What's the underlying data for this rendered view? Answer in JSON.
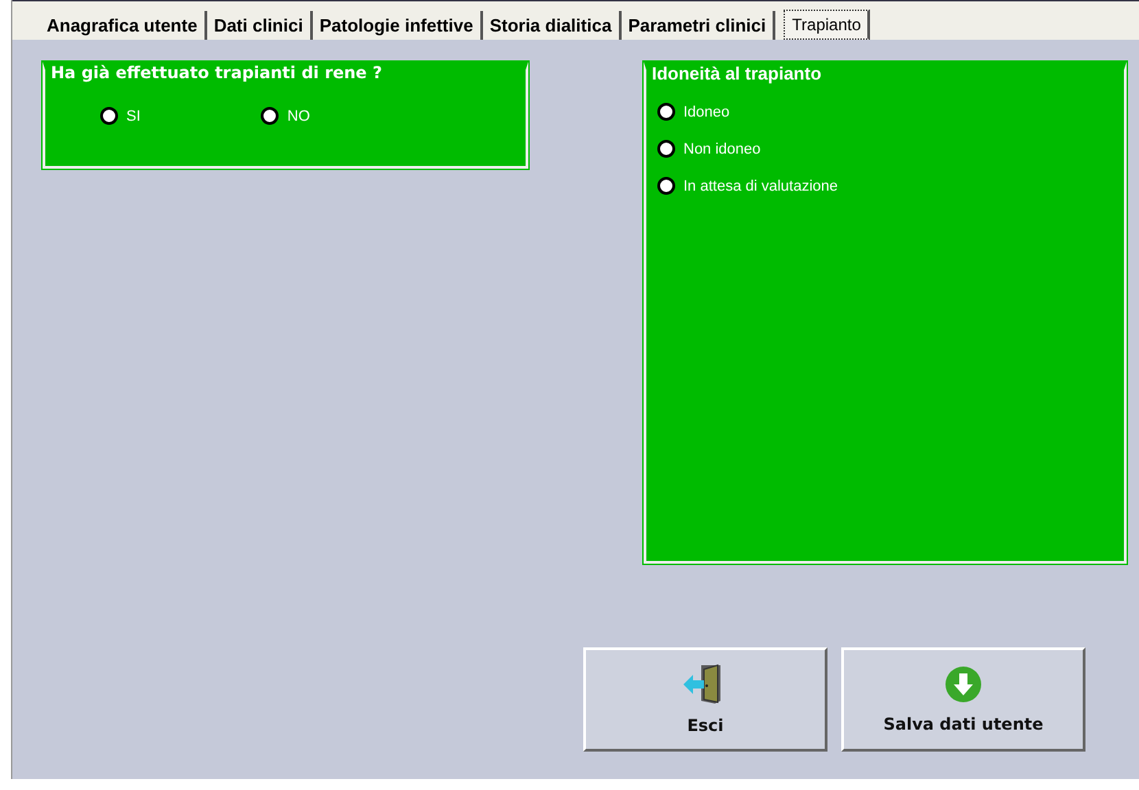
{
  "tabs": [
    {
      "label": "Anagrafica utente",
      "selected": false
    },
    {
      "label": "Dati clinici",
      "selected": false
    },
    {
      "label": "Patologie infettive",
      "selected": false
    },
    {
      "label": "Storia dialitica",
      "selected": false
    },
    {
      "label": "Parametri clinici",
      "selected": false
    },
    {
      "label": "Trapianto",
      "selected": true
    }
  ],
  "transplant_group": {
    "title": "Ha già effettuato trapianti di rene ?",
    "options": [
      {
        "label": "SI",
        "selected": false
      },
      {
        "label": "NO",
        "selected": false
      }
    ]
  },
  "eligibility_group": {
    "title": "Idoneità al trapianto",
    "options": [
      {
        "label": "Idoneo",
        "selected": false
      },
      {
        "label": "Non idoneo",
        "selected": false
      },
      {
        "label": "In attesa di valutazione",
        "selected": false
      }
    ]
  },
  "buttons": [
    {
      "kind": "exit",
      "label": "Esci"
    },
    {
      "kind": "save",
      "label": "Salva dati utente"
    }
  ]
}
